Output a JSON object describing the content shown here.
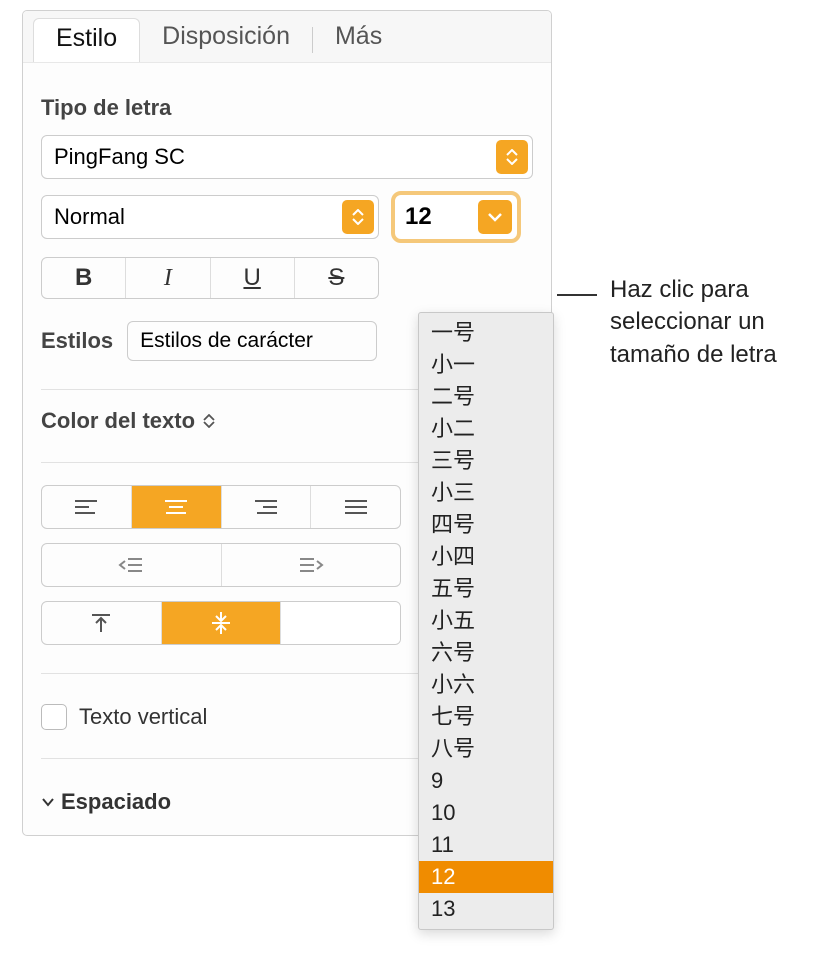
{
  "tabs": {
    "style": "Estilo",
    "layout": "Disposición",
    "more": "Más"
  },
  "font": {
    "section_label": "Tipo de letra",
    "family": "PingFang SC",
    "weight": "Normal",
    "size": "12",
    "bold_glyph": "B",
    "italic_glyph": "I",
    "underline_glyph": "U",
    "strike_glyph": "S"
  },
  "styles": {
    "label": "Estilos",
    "char_styles": "Estilos de carácter"
  },
  "text_color": {
    "label": "Color del texto"
  },
  "vertical_text": {
    "label": "Texto vertical"
  },
  "spacing_label": "Espaciado",
  "size_menu": {
    "items": [
      "一号",
      "小一",
      "二号",
      "小二",
      "三号",
      "小三",
      "四号",
      "小四",
      "五号",
      "小五",
      "六号",
      "小六",
      "七号",
      "八号",
      "9",
      "10",
      "11",
      "12",
      "13"
    ],
    "selected": "12"
  },
  "callout": "Haz clic para seleccionar un tamaño de letra"
}
